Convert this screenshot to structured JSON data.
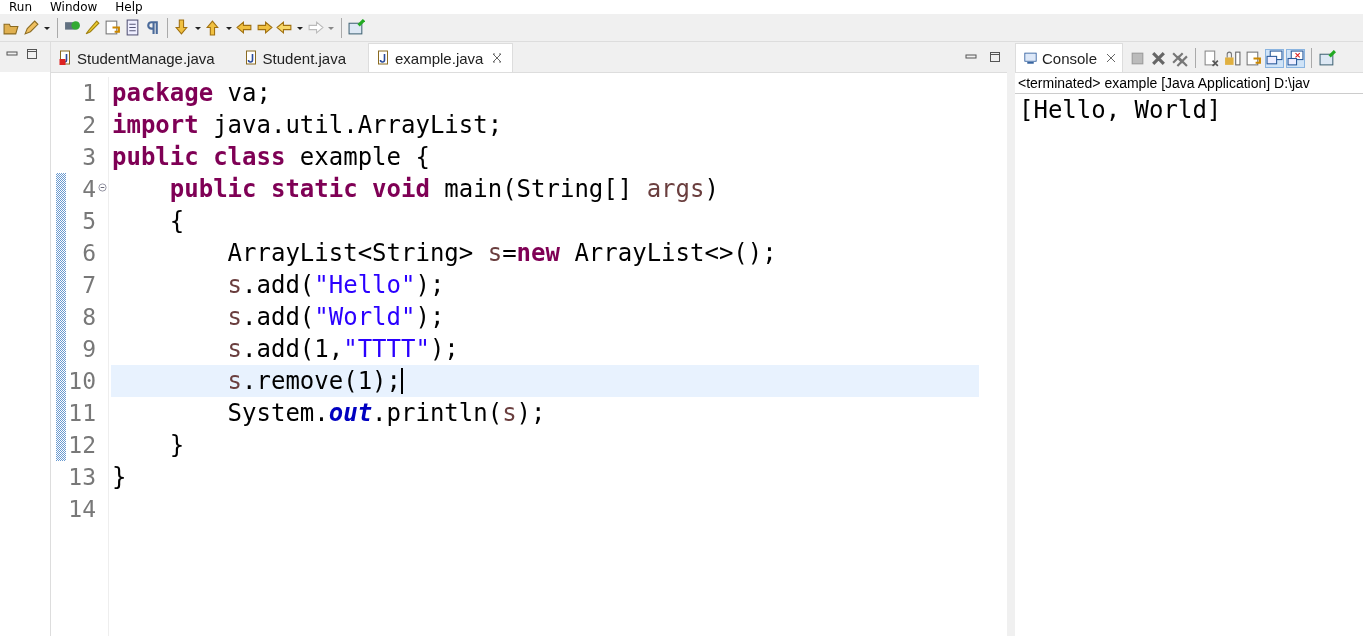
{
  "menu": [
    {
      "label": "Run"
    },
    {
      "label": "Window"
    },
    {
      "label": "Help"
    }
  ],
  "editor": {
    "tabs": [
      {
        "label": "StudentManage.java",
        "selected": false,
        "error": true
      },
      {
        "label": "Student.java",
        "selected": false,
        "error": false
      },
      {
        "label": "example.java",
        "selected": true,
        "error": false
      }
    ],
    "lines": [
      {
        "number": "1",
        "selected": false,
        "changed": false,
        "foldable": false,
        "tokens": [
          {
            "kind": "keyword",
            "text": "package"
          },
          {
            "kind": "plain",
            "text": " va;"
          }
        ]
      },
      {
        "number": "2",
        "selected": false,
        "changed": false,
        "foldable": false,
        "tokens": [
          {
            "kind": "keyword",
            "text": "import"
          },
          {
            "kind": "plain",
            "text": " java.util.ArrayList;"
          }
        ]
      },
      {
        "number": "3",
        "selected": false,
        "changed": false,
        "foldable": false,
        "tokens": [
          {
            "kind": "keyword",
            "text": "public class"
          },
          {
            "kind": "plain",
            "text": " example {"
          }
        ]
      },
      {
        "number": "4",
        "selected": false,
        "changed": true,
        "foldable": true,
        "tokens": [
          {
            "kind": "keyword",
            "text": "    public static void"
          },
          {
            "kind": "plain",
            "text": " main(String[] "
          },
          {
            "kind": "local",
            "text": "args"
          },
          {
            "kind": "plain",
            "text": ")"
          }
        ]
      },
      {
        "number": "5",
        "selected": false,
        "changed": true,
        "foldable": false,
        "tokens": [
          {
            "kind": "plain",
            "text": "    {"
          }
        ]
      },
      {
        "number": "6",
        "selected": false,
        "changed": true,
        "foldable": false,
        "tokens": [
          {
            "kind": "plain",
            "text": "        ArrayList<String> "
          },
          {
            "kind": "local",
            "text": "s"
          },
          {
            "kind": "plain",
            "text": "="
          },
          {
            "kind": "keyword",
            "text": "new"
          },
          {
            "kind": "plain",
            "text": " ArrayList<>();"
          }
        ]
      },
      {
        "number": "7",
        "selected": false,
        "changed": true,
        "foldable": false,
        "tokens": [
          {
            "kind": "local",
            "text": "        s"
          },
          {
            "kind": "plain",
            "text": ".add("
          },
          {
            "kind": "string",
            "text": "\"Hello\""
          },
          {
            "kind": "plain",
            "text": ");"
          }
        ]
      },
      {
        "number": "8",
        "selected": false,
        "changed": true,
        "foldable": false,
        "tokens": [
          {
            "kind": "local",
            "text": "        s"
          },
          {
            "kind": "plain",
            "text": ".add("
          },
          {
            "kind": "string",
            "text": "\"World\""
          },
          {
            "kind": "plain",
            "text": ");"
          }
        ]
      },
      {
        "number": "9",
        "selected": false,
        "changed": true,
        "foldable": false,
        "tokens": [
          {
            "kind": "local",
            "text": "        s"
          },
          {
            "kind": "plain",
            "text": ".add(1,"
          },
          {
            "kind": "string",
            "text": "\"TTTT\""
          },
          {
            "kind": "plain",
            "text": ");"
          }
        ]
      },
      {
        "number": "10",
        "selected": true,
        "changed": true,
        "foldable": false,
        "tokens": [
          {
            "kind": "local",
            "text": "        s"
          },
          {
            "kind": "plain",
            "text": ".remove(1);"
          }
        ]
      },
      {
        "number": "11",
        "selected": false,
        "changed": true,
        "foldable": false,
        "tokens": [
          {
            "kind": "plain",
            "text": "        System."
          },
          {
            "kind": "static-field",
            "text": "out"
          },
          {
            "kind": "plain",
            "text": ".println("
          },
          {
            "kind": "local",
            "text": "s"
          },
          {
            "kind": "plain",
            "text": ");"
          }
        ]
      },
      {
        "number": "12",
        "selected": false,
        "changed": true,
        "foldable": false,
        "tokens": [
          {
            "kind": "plain",
            "text": "    }"
          }
        ]
      },
      {
        "number": "13",
        "selected": false,
        "changed": false,
        "foldable": false,
        "tokens": [
          {
            "kind": "plain",
            "text": "}"
          }
        ]
      },
      {
        "number": "14",
        "selected": false,
        "changed": false,
        "foldable": false
      }
    ]
  },
  "console": {
    "title": "Console",
    "status": "<terminated> example [Java Application] D:\\jav",
    "output": "[Hello, World]"
  }
}
